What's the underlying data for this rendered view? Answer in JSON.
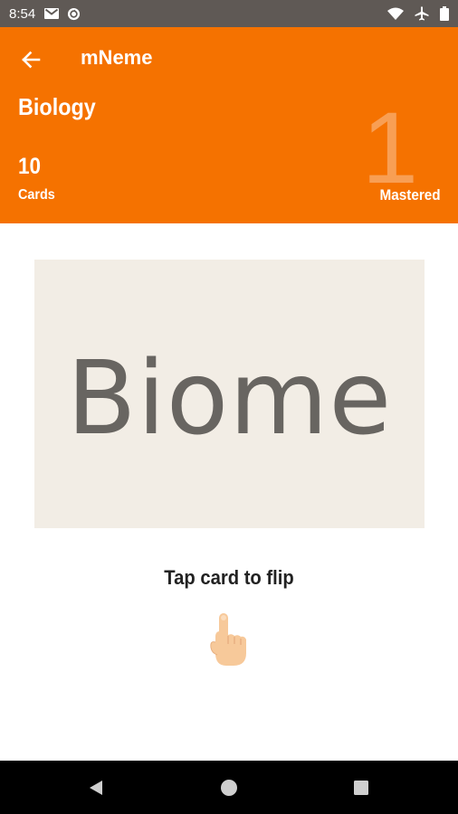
{
  "status_bar": {
    "time": "8:54",
    "left_icons": [
      "gmail-icon",
      "sync-icon"
    ],
    "right_icons": [
      "wifi-icon",
      "airplane-icon",
      "battery-icon"
    ]
  },
  "header": {
    "app_title": "mNeme",
    "deck_title": "Biology",
    "cards_count": "10",
    "cards_label": "Cards",
    "mastered_count": "1",
    "mastered_label": "Mastered"
  },
  "card": {
    "term": "Biome"
  },
  "hint": {
    "text": "Tap card to flip",
    "icon": "tap-hand-icon"
  },
  "nav_bar": {
    "buttons": [
      "back-triangle-icon",
      "home-circle-icon",
      "recents-square-icon"
    ]
  },
  "colors": {
    "status_bar": "#5f5955",
    "header": "#f57200",
    "mastered_number": "#f9a763",
    "card_background": "#f2ede5",
    "card_text": "#686561",
    "nav_bar": "#000000"
  }
}
